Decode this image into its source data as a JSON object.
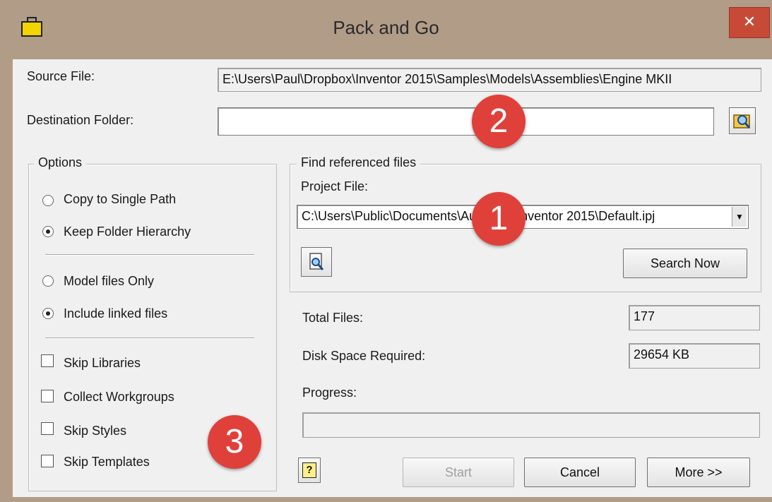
{
  "window": {
    "title": "Pack and Go",
    "close_label": "✕"
  },
  "source": {
    "label": "Source File:",
    "value": "E:\\Users\\Paul\\Dropbox\\Inventor 2015\\Samples\\Models\\Assemblies\\Engine MKII"
  },
  "destination": {
    "label": "Destination Folder:",
    "value": ""
  },
  "options": {
    "title": "Options",
    "path_mode": [
      {
        "label": "Copy to Single Path",
        "selected": false
      },
      {
        "label": "Keep Folder Hierarchy",
        "selected": true
      }
    ],
    "file_mode": [
      {
        "label": "Model files Only",
        "selected": false
      },
      {
        "label": "Include linked files",
        "selected": true
      }
    ],
    "checks": [
      {
        "label": "Skip Libraries",
        "checked": false
      },
      {
        "label": "Collect Workgroups",
        "checked": false
      },
      {
        "label": "Skip Styles",
        "checked": false
      },
      {
        "label": "Skip Templates",
        "checked": false
      }
    ]
  },
  "find": {
    "title": "Find referenced files",
    "project_label": "Project File:",
    "project_value": "C:\\Users\\Public\\Documents\\Autodesk\\Inventor 2015\\Default.ipj",
    "search_label": "Search Now"
  },
  "stats": {
    "total_label": "Total Files:",
    "total_value": "177",
    "disk_label": "Disk Space Required:",
    "disk_value": "29654 KB",
    "progress_label": "Progress:",
    "progress": 0
  },
  "buttons": {
    "help": "?",
    "start": "Start",
    "cancel": "Cancel",
    "more": "More >>"
  },
  "badges": {
    "one": "1",
    "two": "2",
    "three": "3"
  },
  "colors": {
    "badge": "#e0403a",
    "close": "#c74a36",
    "frame": "#b19c88"
  }
}
